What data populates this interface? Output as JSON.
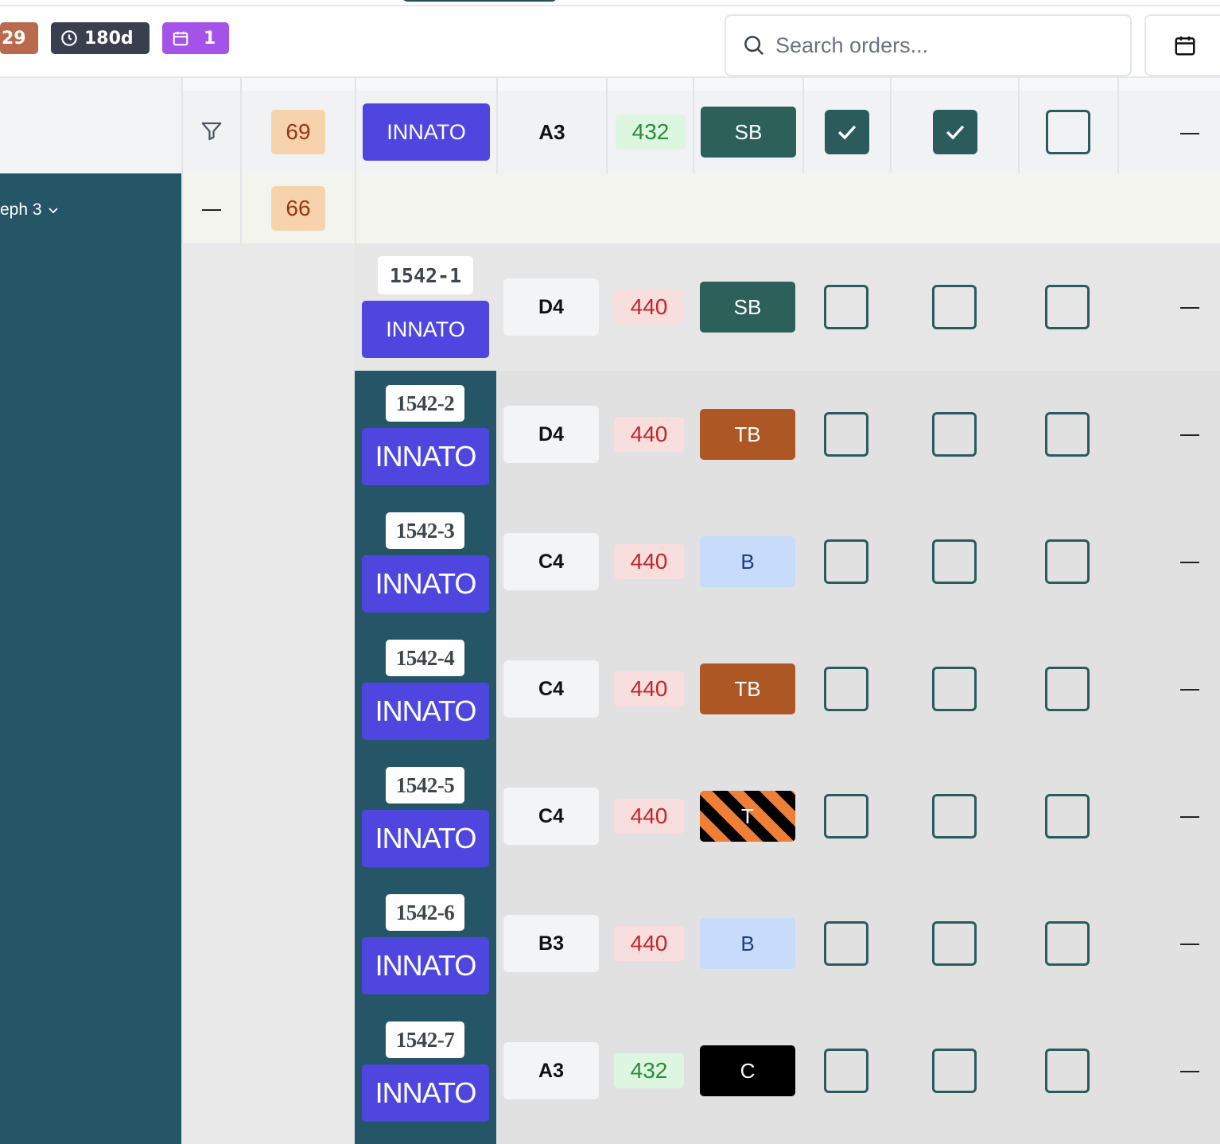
{
  "toolbar": {
    "count_badge": "29",
    "days_badge": "180d",
    "calendar_badge": "1",
    "search_placeholder": "Search orders..."
  },
  "sidebar": {
    "group_label": "eph 3"
  },
  "header_row": {
    "count": "69",
    "brand": "INNATO",
    "position": "A3",
    "value": "432",
    "type": "SB",
    "check1": true,
    "check2": true,
    "check3": false,
    "dash": "—"
  },
  "group_row": {
    "dash": "—",
    "count": "66"
  },
  "rows": [
    {
      "id": "1542-1",
      "brand": "INNATO",
      "position": "D4",
      "value": "440",
      "type": "SB",
      "c1": false,
      "c2": false,
      "c3": false,
      "dash": "—"
    },
    {
      "id": "1542-2",
      "brand": "INNATO",
      "position": "D4",
      "value": "440",
      "type": "TB",
      "c1": false,
      "c2": false,
      "c3": false,
      "dash": "—"
    },
    {
      "id": "1542-3",
      "brand": "INNATO",
      "position": "C4",
      "value": "440",
      "type": "B",
      "c1": false,
      "c2": false,
      "c3": false,
      "dash": "—"
    },
    {
      "id": "1542-4",
      "brand": "INNATO",
      "position": "C4",
      "value": "440",
      "type": "TB",
      "c1": false,
      "c2": false,
      "c3": false,
      "dash": "—"
    },
    {
      "id": "1542-5",
      "brand": "INNATO",
      "position": "C4",
      "value": "440",
      "type": "T",
      "c1": false,
      "c2": false,
      "c3": false,
      "dash": "—"
    },
    {
      "id": "1542-6",
      "brand": "INNATO",
      "position": "B3",
      "value": "440",
      "type": "B",
      "c1": false,
      "c2": false,
      "c3": false,
      "dash": "—"
    },
    {
      "id": "1542-7",
      "brand": "INNATO",
      "position": "A3",
      "value": "432",
      "type": "C",
      "c1": false,
      "c2": false,
      "c3": false,
      "dash": "—"
    }
  ],
  "colors": {
    "brand": "#4f46e0",
    "teal": "#245667",
    "sb": "#2c6059",
    "tb": "#ad5725",
    "b": "#c7dcfa",
    "c": "#000000"
  }
}
